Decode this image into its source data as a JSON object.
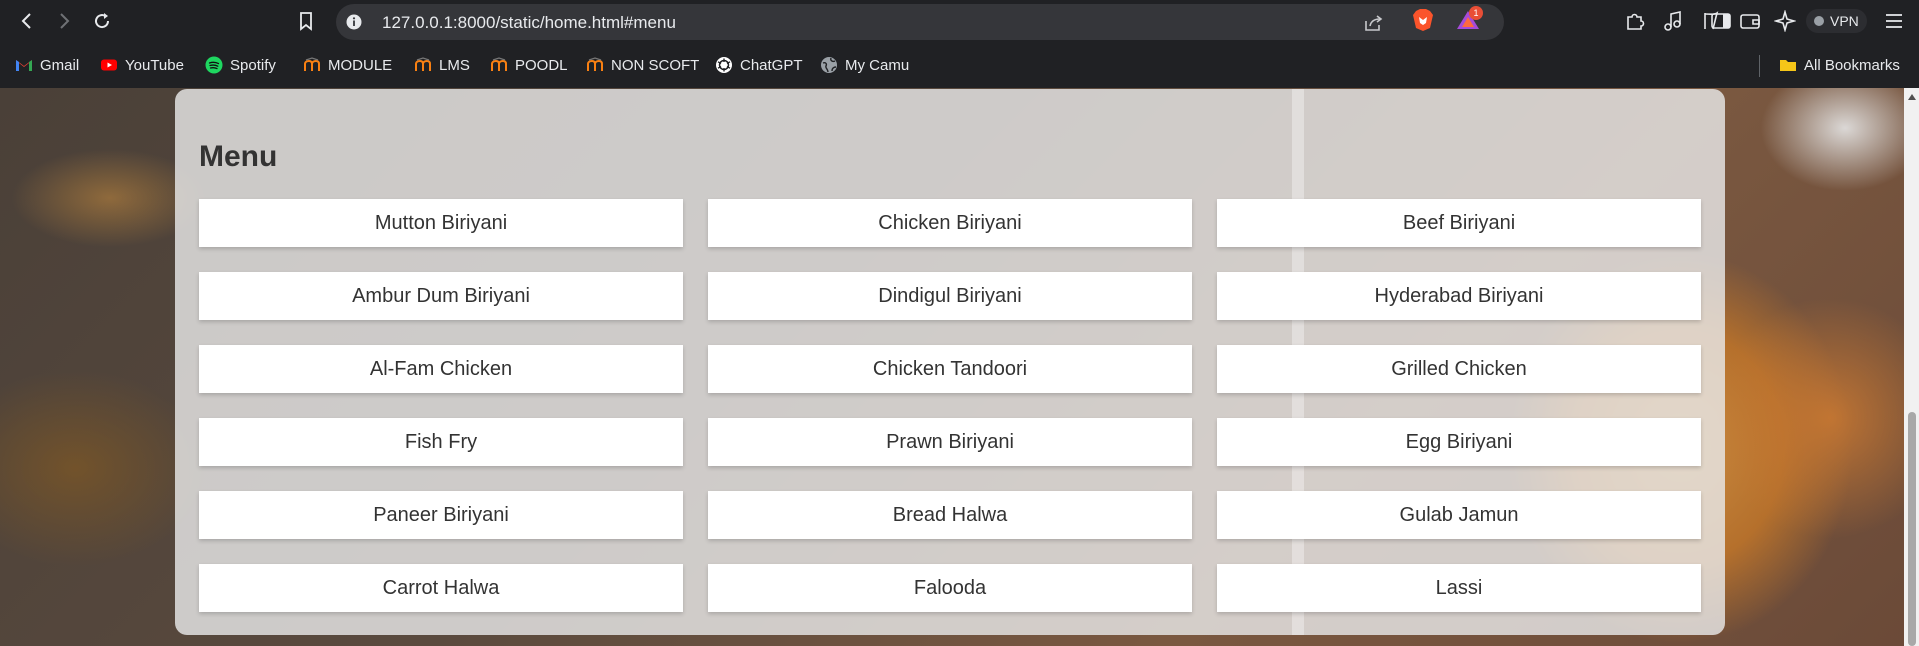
{
  "browser": {
    "url": "127.0.0.1:8000/static/home.html#menu",
    "vpn_label": "VPN",
    "rewards_badge": "1",
    "icons": [
      "back-icon",
      "forward-icon",
      "reload-icon",
      "bookmark-icon",
      "site-info-icon",
      "share-icon",
      "brave-shields-icon",
      "brave-rewards-icon",
      "extensions-icon",
      "media-icon",
      "sidebar-icon",
      "wallet-icon",
      "leo-ai-icon",
      "menu-icon"
    ]
  },
  "bookmarks": [
    {
      "label": "Gmail",
      "icon": "gmail-icon"
    },
    {
      "label": "YouTube",
      "icon": "youtube-icon"
    },
    {
      "label": "Spotify",
      "icon": "spotify-icon"
    },
    {
      "label": "MODULE",
      "icon": "moodle-icon"
    },
    {
      "label": "LMS",
      "icon": "moodle-icon"
    },
    {
      "label": "POODL",
      "icon": "moodle-icon"
    },
    {
      "label": "NON SCOFT",
      "icon": "moodle-icon"
    },
    {
      "label": "ChatGPT",
      "icon": "chatgpt-icon"
    },
    {
      "label": "My Camu",
      "icon": "globe-icon"
    }
  ],
  "all_bookmarks_label": "All Bookmarks",
  "menu": {
    "title": "Menu",
    "items": [
      "Mutton Biriyani",
      "Chicken Biriyani",
      "Beef Biriyani",
      "Ambur Dum Biriyani",
      "Dindigul Biriyani",
      "Hyderabad Biriyani",
      "Al-Fam Chicken",
      "Chicken Tandoori",
      "Grilled Chicken",
      "Fish Fry",
      "Prawn Biriyani",
      "Egg Biriyani",
      "Paneer Biriyani",
      "Bread Halwa",
      "Gulab Jamun",
      "Carrot Halwa",
      "Falooda",
      "Lassi"
    ]
  },
  "colors": {
    "chrome_bg": "#202124",
    "omnibox_bg": "#35363a",
    "panel_bg": "#e8e8e8",
    "item_bg": "#ffffff",
    "text": "#333333"
  }
}
